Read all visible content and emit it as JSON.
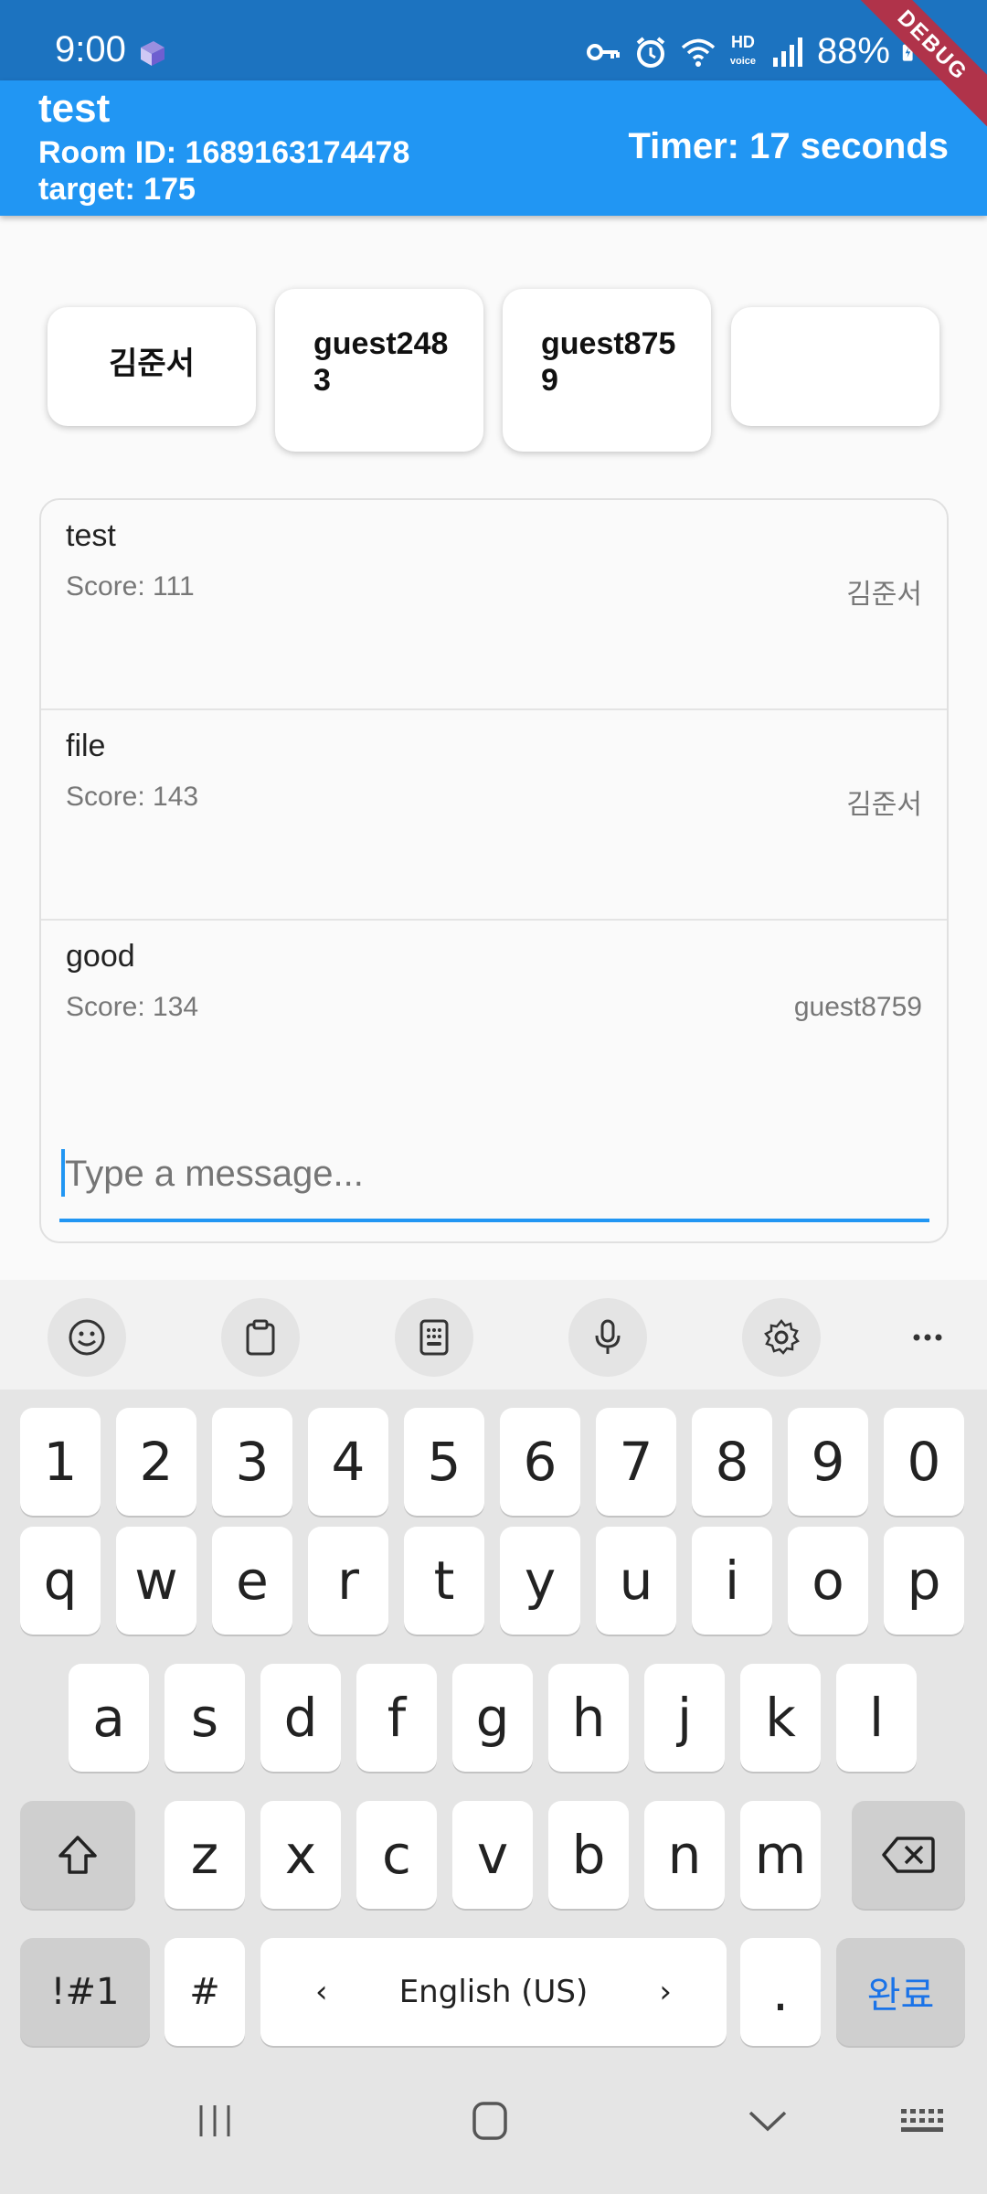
{
  "status_bar": {
    "time": "9:00",
    "battery": "88%",
    "hd_label": "HD",
    "hd_sub": "voice"
  },
  "debug_label": "DEBUG",
  "app_bar": {
    "title": "test",
    "room_id": "Room ID: 1689163174478",
    "target": "target: 175",
    "timer": "Timer: 17 seconds"
  },
  "players": [
    "김준서",
    "guest2483",
    "guest8759",
    ""
  ],
  "messages": [
    {
      "text": "test",
      "score": "Score: 111",
      "user": "김준서"
    },
    {
      "text": "file",
      "score": "Score: 143",
      "user": "김준서"
    },
    {
      "text": "good",
      "score": "Score: 134",
      "user": "guest8759"
    }
  ],
  "input": {
    "placeholder": "Type a message..."
  },
  "keyboard": {
    "toolbar": [
      "emoji-icon",
      "clipboard-icon",
      "keypad-icon",
      "mic-icon",
      "settings-icon",
      "more-icon"
    ],
    "row_numbers": [
      "1",
      "2",
      "3",
      "4",
      "5",
      "6",
      "7",
      "8",
      "9",
      "0"
    ],
    "row1": [
      "q",
      "w",
      "e",
      "r",
      "t",
      "y",
      "u",
      "i",
      "o",
      "p"
    ],
    "row2": [
      "a",
      "s",
      "d",
      "f",
      "g",
      "h",
      "j",
      "k",
      "l"
    ],
    "row3": [
      "z",
      "x",
      "c",
      "v",
      "b",
      "n",
      "m"
    ],
    "symbols_key": "!#1",
    "hash_key": "#",
    "space_label": "English (US)",
    "period_key": ".",
    "done_key": "완료",
    "accent_color": "#1a73e8"
  },
  "nav": [
    "recents-icon",
    "home-icon",
    "back-icon",
    "keyboard-switch-icon"
  ]
}
